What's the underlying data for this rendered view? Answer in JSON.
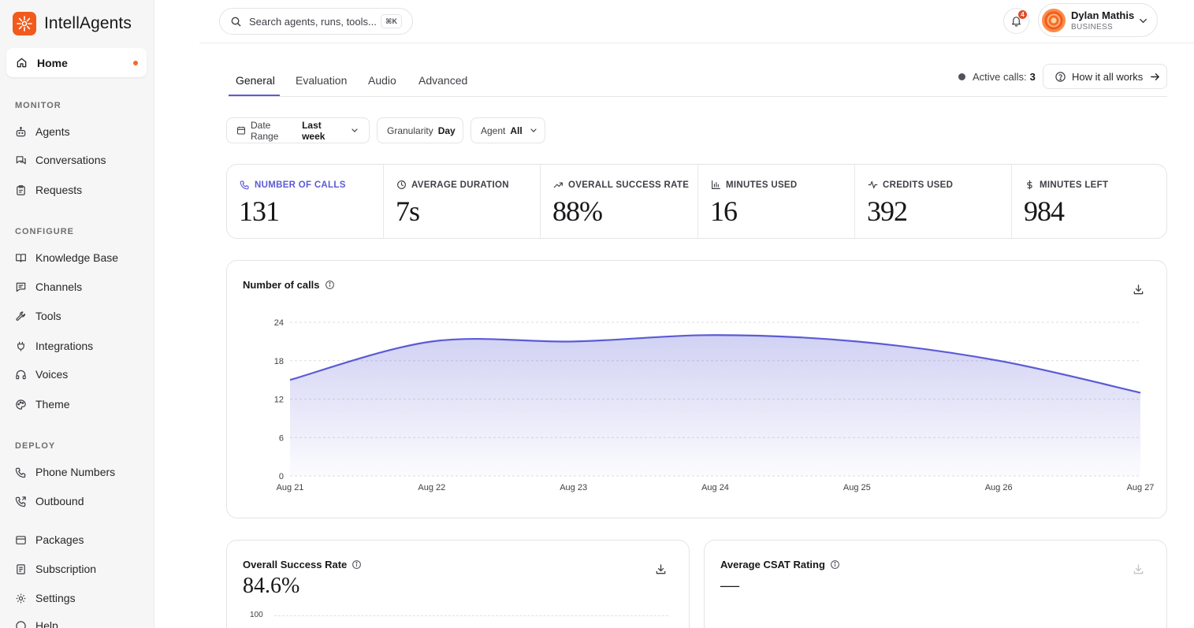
{
  "app": {
    "name": "IntellAgents"
  },
  "sidebar": {
    "home": {
      "label": "Home"
    },
    "sections": [
      {
        "title": "MONITOR",
        "items": [
          {
            "label": "Agents",
            "icon": "bot-icon"
          },
          {
            "label": "Conversations",
            "icon": "chat-icon"
          },
          {
            "label": "Requests",
            "icon": "clipboard-icon"
          }
        ]
      },
      {
        "title": "CONFIGURE",
        "items": [
          {
            "label": "Knowledge Base",
            "icon": "book-icon"
          },
          {
            "label": "Channels",
            "icon": "message-square-icon"
          },
          {
            "label": "Tools",
            "icon": "wrench-icon"
          },
          {
            "label": "Integrations",
            "icon": "plug-icon"
          },
          {
            "label": "Voices",
            "icon": "headphones-icon"
          },
          {
            "label": "Theme",
            "icon": "palette-icon"
          }
        ]
      },
      {
        "title": "DEPLOY",
        "items": [
          {
            "label": "Phone Numbers",
            "icon": "phone-icon"
          },
          {
            "label": "Outbound",
            "icon": "phone-outgoing-icon"
          }
        ]
      },
      {
        "title": "",
        "items": [
          {
            "label": "Packages",
            "icon": "package-icon"
          },
          {
            "label": "Subscription",
            "icon": "receipt-icon"
          },
          {
            "label": "Settings",
            "icon": "gear-icon"
          },
          {
            "label": "Help",
            "icon": "help-icon"
          }
        ]
      }
    ]
  },
  "topbar": {
    "search_placeholder": "Search agents, runs, tools...",
    "shortcut": "⌘K",
    "notifications_count": "4",
    "user": {
      "name": "Dylan Mathis",
      "role": "BUSINESS"
    }
  },
  "tabs": [
    {
      "label": "General",
      "active": true
    },
    {
      "label": "Evaluation"
    },
    {
      "label": "Audio"
    },
    {
      "label": "Advanced"
    }
  ],
  "active_calls": {
    "label": "Active calls:",
    "value": "3"
  },
  "how_button": {
    "label": "How it all works"
  },
  "filters": [
    {
      "label": "Date Range",
      "value": "Last week",
      "has_chevron": true,
      "icon": "calendar-icon"
    },
    {
      "label": "Granularity",
      "value": "Day",
      "has_chevron": false
    },
    {
      "label": "Agent",
      "value": "All",
      "has_chevron": true
    }
  ],
  "stats": [
    {
      "label": "NUMBER OF CALLS",
      "value": "131",
      "icon": "phone-icon",
      "active": true
    },
    {
      "label": "AVERAGE DURATION",
      "value": "7s",
      "icon": "clock-icon"
    },
    {
      "label": "OVERALL SUCCESS RATE",
      "value": "88%",
      "icon": "trending-up-icon"
    },
    {
      "label": "MINUTES USED",
      "value": "16",
      "icon": "bar-chart-icon"
    },
    {
      "label": "CREDITS USED",
      "value": "392",
      "icon": "activity-icon"
    },
    {
      "label": "MINUTES LEFT",
      "value": "984",
      "icon": "dollar-icon"
    }
  ],
  "calls_card": {
    "title": "Number of calls"
  },
  "success_card": {
    "title": "Overall Success Rate",
    "value": "84.6%",
    "axis_top": "100"
  },
  "csat_card": {
    "title": "Average CSAT Rating",
    "value": "—"
  },
  "colors": {
    "accent": "#5b5bd6",
    "brand": "#f25a1d"
  },
  "chart_data": {
    "type": "area",
    "title": "Number of calls",
    "x": [
      "Aug 21",
      "Aug 22",
      "Aug 23",
      "Aug 24",
      "Aug 25",
      "Aug 26",
      "Aug 27"
    ],
    "values": [
      15,
      21,
      21,
      22,
      21,
      18,
      13
    ],
    "yticks": [
      0,
      6,
      12,
      18,
      24
    ],
    "ylim": [
      0,
      24
    ],
    "grid": true
  }
}
